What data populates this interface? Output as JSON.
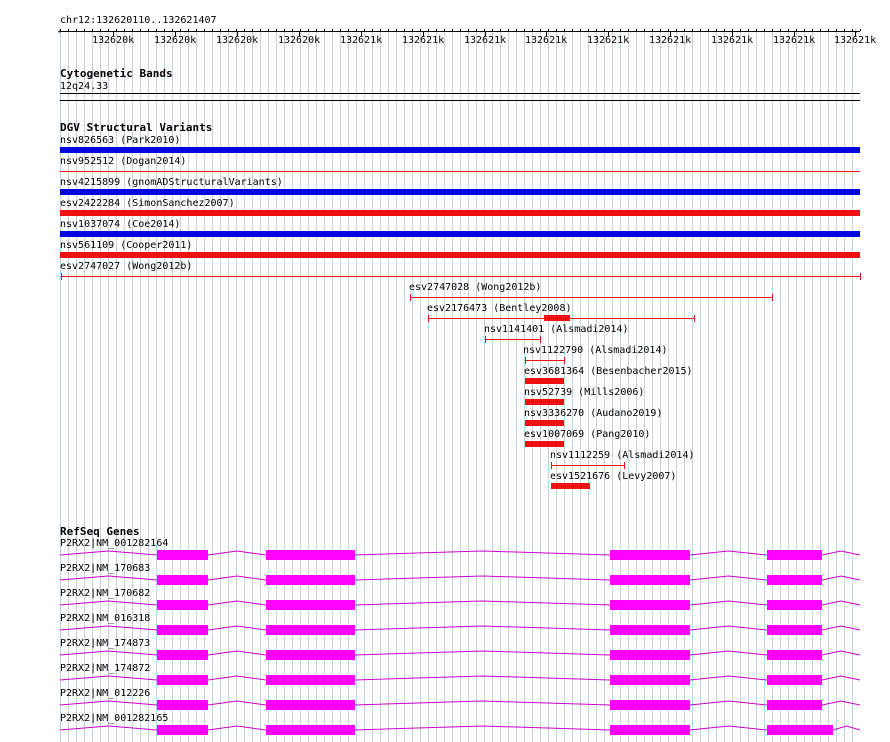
{
  "ruler": {
    "label": "chr12:132620110..132621407",
    "ticks": [
      "132620k",
      "132620k",
      "132620k",
      "132620k",
      "132621k",
      "132621k",
      "132621k",
      "132621k",
      "132621k",
      "132621k",
      "132621k",
      "132621k",
      "132621k"
    ]
  },
  "tracks": {
    "cyto": {
      "title": "Cytogenetic Bands",
      "band": "12q24.33"
    },
    "dgv": {
      "title": "DGV Structural Variants",
      "colors": {
        "gain": "#0000dd",
        "loss": "#ee1111"
      },
      "items": [
        {
          "label": "nsv826563 (Park2010)",
          "kind": "gain",
          "style": "thick"
        },
        {
          "label": "nsv952512 (Dogan2014)",
          "kind": "loss",
          "style": "line"
        },
        {
          "label": "nsv4215899 (gnomADStructuralVariants)",
          "kind": "gain",
          "style": "thick"
        },
        {
          "label": "esv2422284 (SimonSanchez2007)",
          "kind": "loss",
          "style": "thick"
        },
        {
          "label": "nsv1037074 (Coe2014)",
          "kind": "gain",
          "style": "thick"
        },
        {
          "label": "nsv561109 (Cooper2011)",
          "kind": "loss",
          "style": "thick"
        },
        {
          "label": "esv2747027 (Wong2012b)",
          "kind": "loss",
          "style": "range"
        },
        {
          "label": "esv2747028 (Wong2012b)",
          "kind": "loss",
          "style": "range"
        },
        {
          "label": "esv2176473 (Bentley2008)",
          "kind": "loss",
          "style": "range-block"
        },
        {
          "label": "nsv1141401 (Alsmadi2014)",
          "kind": "loss",
          "style": "range"
        },
        {
          "label": "nsv1122790 (Alsmadi2014)",
          "kind": "loss",
          "style": "range"
        },
        {
          "label": "esv3681364 (Besenbacher2015)",
          "kind": "loss",
          "style": "thick"
        },
        {
          "label": "nsv52739 (Mills2006)",
          "kind": "loss",
          "style": "thick"
        },
        {
          "label": "nsv3336270 (Audano2019)",
          "kind": "loss",
          "style": "thick"
        },
        {
          "label": "esv1007069 (Pang2010)",
          "kind": "loss",
          "style": "thick"
        },
        {
          "label": "nsv1112259 (Alsmadi2014)",
          "kind": "loss",
          "style": "range"
        },
        {
          "label": "esv1521676 (Levy2007)",
          "kind": "loss",
          "style": "thick"
        }
      ]
    },
    "refseq": {
      "title": "RefSeq Genes",
      "exon_color": "#ff00ff",
      "intron_color": "#cc00cc",
      "transcripts": [
        {
          "label": "P2RX2|NM_001282164"
        },
        {
          "label": "P2RX2|NM_170683"
        },
        {
          "label": "P2RX2|NM_170682"
        },
        {
          "label": "P2RX2|NM_016318"
        },
        {
          "label": "P2RX2|NM_174873"
        },
        {
          "label": "P2RX2|NM_174872"
        },
        {
          "label": "P2RX2|NM_012226"
        },
        {
          "label": "P2RX2|NM_001282165"
        }
      ]
    }
  }
}
